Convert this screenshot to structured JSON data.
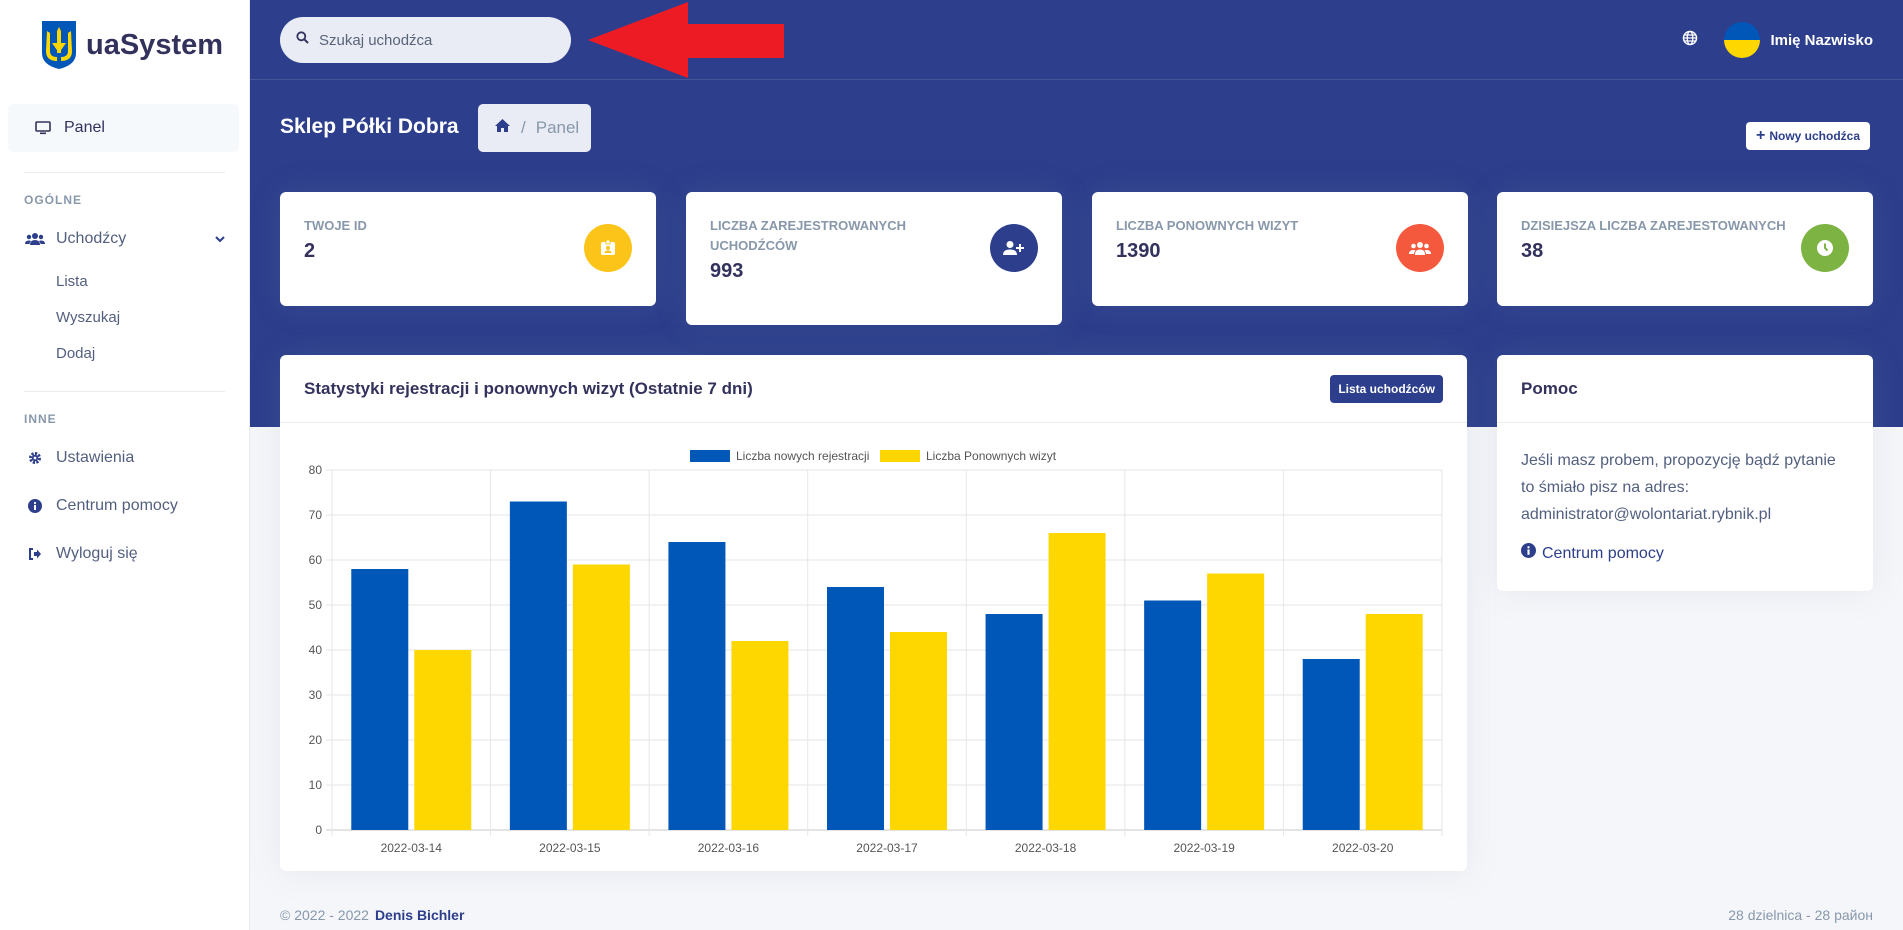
{
  "brand": {
    "name": "uaSystem"
  },
  "search": {
    "placeholder": "Szukaj uchodźca"
  },
  "user": {
    "name": "Imię Nazwisko"
  },
  "sidebar": {
    "panel_label": "Panel",
    "general_heading": "OGÓLNE",
    "refugees_label": "Uchodźcy",
    "sub_items": [
      "Lista",
      "Wyszukaj",
      "Dodaj"
    ],
    "other_heading": "INNE",
    "settings_label": "Ustawienia",
    "help_label": "Centrum pomocy",
    "logout_label": "Wyloguj się"
  },
  "header": {
    "title": "Sklep Półki Dobra",
    "breadcrumb_current": "Panel",
    "breadcrumb_separator": "/",
    "new_button": "Nowy uchodźca"
  },
  "stats": [
    {
      "label": "TWOJE ID",
      "value": "2",
      "color": "#fcc419",
      "icon": "id-badge-icon"
    },
    {
      "label": "LICZBA ZAREJESTROWANYCH UCHODŹCÓW",
      "value": "993",
      "color": "#2c3e8c",
      "icon": "user-plus-icon"
    },
    {
      "label": "LICZBA PONOWNYCH WIZYT",
      "value": "1390",
      "color": "#f5593d",
      "icon": "users-icon"
    },
    {
      "label": "DZISIEJSZA LICZBA ZAREJESTOWANYCH",
      "value": "38",
      "color": "#7cb342",
      "icon": "clock-icon"
    }
  ],
  "chart_card": {
    "title": "Statystyki rejestracji i ponownych wizyt (Ostatnie 7 dni)",
    "button": "Lista uchodźców"
  },
  "chart_data": {
    "type": "bar",
    "categories": [
      "2022-03-14",
      "2022-03-15",
      "2022-03-16",
      "2022-03-17",
      "2022-03-18",
      "2022-03-19",
      "2022-03-20"
    ],
    "series": [
      {
        "name": "Liczba nowych rejestracji",
        "color": "#0057b8",
        "values": [
          58,
          73,
          64,
          54,
          48,
          51,
          38
        ]
      },
      {
        "name": "Liczba Ponownych wizyt",
        "color": "#ffd700",
        "values": [
          40,
          59,
          42,
          44,
          66,
          57,
          48
        ]
      }
    ],
    "ylim": [
      0,
      80
    ],
    "yticks": [
      0,
      10,
      20,
      30,
      40,
      50,
      60,
      70,
      80
    ],
    "grid": true,
    "legend": "top-center"
  },
  "help": {
    "title": "Pomoc",
    "text": "Jeśli masz probem, propozycję bądź pytanie to śmiało pisz na adres: administrator@wolontariat.rybnik.pl",
    "link": "Centrum pomocy"
  },
  "footer": {
    "copyright": "© 2022 - 2022",
    "author": "Denis Bichler",
    "right": "28 dzielnica - 28 район"
  },
  "colors": {
    "primary": "#2c3e8c",
    "ukraine_blue": "#0057b8",
    "ukraine_yellow": "#ffd700"
  }
}
